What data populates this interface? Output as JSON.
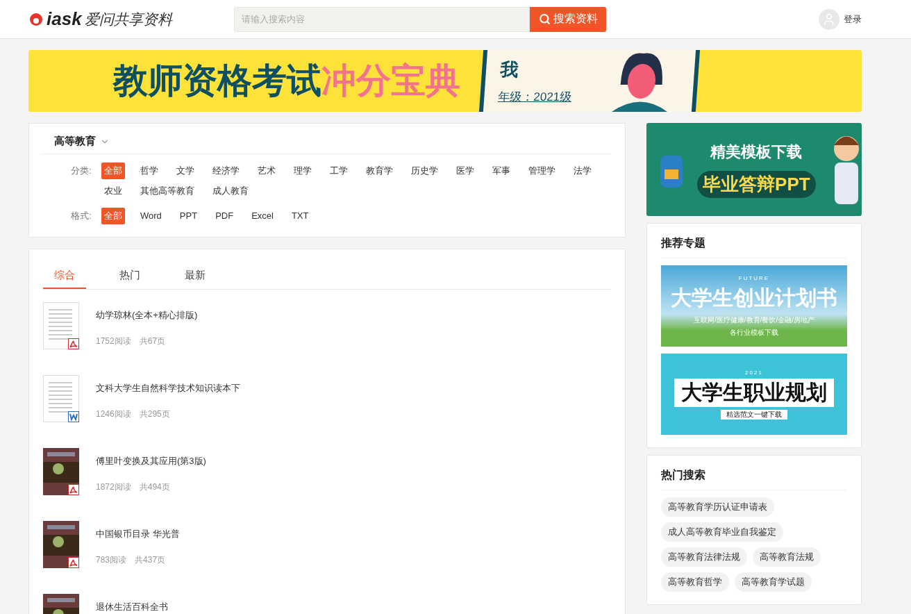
{
  "header": {
    "logo_mark": "iask",
    "logo_text": "爱问共享资料",
    "search": {
      "placeholder": "请输入搜索内容",
      "button": "搜索资料"
    },
    "login": "登录"
  },
  "banner": {
    "title": "教师资格考试",
    "highlight": "冲分宝典",
    "name": "我",
    "grade": "年级：2021级"
  },
  "filter": {
    "category": "高等教育",
    "groups": [
      {
        "label": "分类:",
        "options": [
          {
            "label": "全部",
            "selected": true
          },
          {
            "label": "哲学",
            "selected": false
          },
          {
            "label": "文学",
            "selected": false
          },
          {
            "label": "经济学",
            "selected": false
          },
          {
            "label": "艺术",
            "selected": false
          },
          {
            "label": "理学",
            "selected": false
          },
          {
            "label": "工学",
            "selected": false
          },
          {
            "label": "教育学",
            "selected": false
          },
          {
            "label": "历史学",
            "selected": false
          },
          {
            "label": "医学",
            "selected": false
          },
          {
            "label": "军事",
            "selected": false
          },
          {
            "label": "管理学",
            "selected": false
          },
          {
            "label": "法学",
            "selected": false
          },
          {
            "label": "农业",
            "selected": false
          },
          {
            "label": "其他高等教育",
            "selected": false
          },
          {
            "label": "成人教育",
            "selected": false
          }
        ]
      },
      {
        "label": "格式:",
        "options": [
          {
            "label": "全部",
            "selected": true
          },
          {
            "label": "Word",
            "selected": false
          },
          {
            "label": "PPT",
            "selected": false
          },
          {
            "label": "PDF",
            "selected": false
          },
          {
            "label": "Excel",
            "selected": false
          },
          {
            "label": "TXT",
            "selected": false
          }
        ]
      }
    ]
  },
  "tabs": [
    {
      "label": "综合",
      "selected": true
    },
    {
      "label": "热门",
      "selected": false
    },
    {
      "label": "最新",
      "selected": false
    }
  ],
  "documents": [
    {
      "title": "幼学琼林(全本+精心排版)",
      "reads": "1752阅读",
      "pages": "共67页",
      "kind": "pdfpage"
    },
    {
      "title": "文科大学生自然科学技术知识读本下",
      "reads": "1246阅读",
      "pages": "共295页",
      "kind": "wordpage"
    },
    {
      "title": "傅里叶变换及其应用(第3版)",
      "reads": "1872阅读",
      "pages": "共494页",
      "kind": "pdfcover"
    },
    {
      "title": "中国银币目录 华光普",
      "reads": "783阅读",
      "pages": "共437页",
      "kind": "pdfcover"
    },
    {
      "title": "退休生活百科全书",
      "kind": "cover"
    }
  ],
  "side_ad": {
    "title": "精美模板下载",
    "subtitle": "毕业答辩PPT"
  },
  "topics": {
    "title": "推荐专题",
    "items": [
      {
        "kind": "sky",
        "tag": "FUTURE",
        "title": "大学生创业计划书",
        "line1": "互联网/医疗健康/教育/餐饮/金融/房地产",
        "line2": "各行业模板下载"
      },
      {
        "kind": "scroll",
        "tag": "2021",
        "title": "大学生职业规划",
        "line1": "精选范文一键下载"
      }
    ]
  },
  "hot": {
    "title": "热门搜索",
    "tags": [
      "高等教育学历认证申请表",
      "成人高等教育毕业自我鉴定",
      "高等教育法律法规",
      "高等教育法规",
      "高等教育哲学",
      "高等教育学试题"
    ]
  }
}
